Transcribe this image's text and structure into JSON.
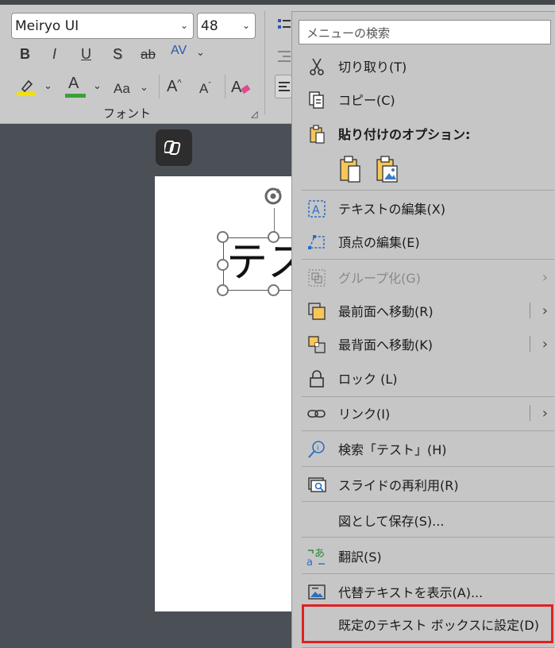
{
  "ribbon": {
    "font_name": "Meiryo UI",
    "font_size": "48",
    "bold": "B",
    "italic": "I",
    "underline": "U",
    "shadow": "S",
    "strike": "ab",
    "spacing": "AV",
    "font_color_glyph": "A",
    "case_glyph": "Aa",
    "grow_glyph": "A",
    "shrink_glyph": "A",
    "group_label": "フォント",
    "highlight_color": "#f5e100",
    "font_color_bar": "#3aa13a"
  },
  "slide": {
    "shape_text": "テス"
  },
  "context_menu": {
    "search_placeholder": "メニューの検索",
    "items": {
      "cut": "切り取り(T)",
      "copy": "コピー(C)",
      "paste_options": "貼り付けのオプション:",
      "edit_text": "テキストの編集(X)",
      "edit_points": "頂点の編集(E)",
      "group": "グループ化(G)",
      "bring_front": "最前面へ移動(R)",
      "send_back": "最背面へ移動(K)",
      "lock": "ロック (L)",
      "link": "リンク(I)",
      "search": "検索「テスト」(H)",
      "reuse_slides": "スライドの再利用(R)",
      "save_as_picture": "図として保存(S)...",
      "translate": "翻訳(S)",
      "alt_text": "代替テキストを表示(A)...",
      "set_default_textbox": "既定のテキスト ボックスに設定(D)"
    },
    "submenu_arrow": "›",
    "highlight_color": "#e02020"
  }
}
